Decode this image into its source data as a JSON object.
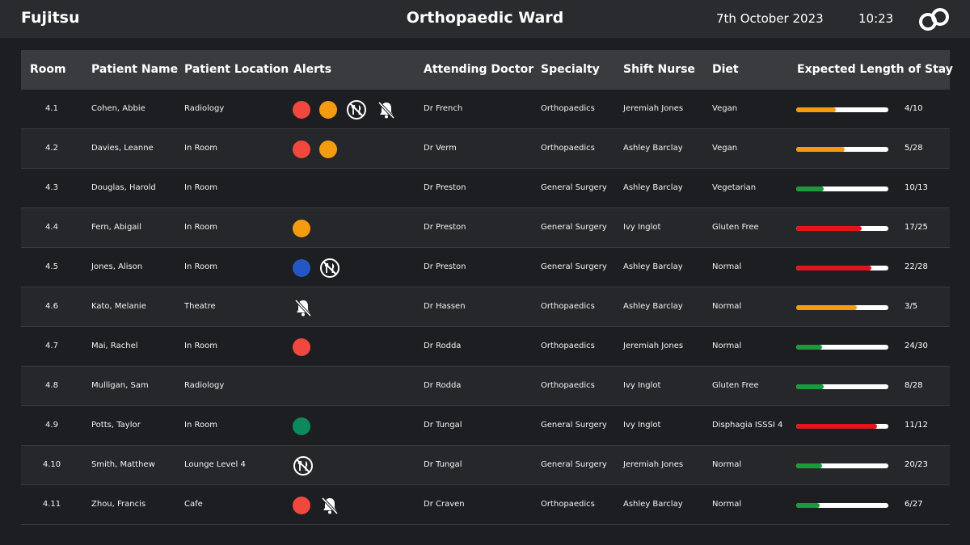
{
  "header": {
    "brand": "Fujitsu",
    "title": "Orthopaedic Ward",
    "date": "7th October 2023",
    "time": "10:23"
  },
  "colors": {
    "red": "#f0483e",
    "orange": "#f39c12",
    "blue": "#2457c5",
    "green": "#0d8a5c",
    "bar_green": "#1a9b3b",
    "bar_orange": "#f39c12",
    "bar_red": "#e3151b"
  },
  "columns": {
    "room": "Room",
    "patient_name": "Patient Name",
    "patient_location": "Patient Location",
    "alerts": "Alerts",
    "attending_doctor": "Attending Doctor",
    "specialty": "Specialty",
    "shift_nurse": "Shift Nurse",
    "diet": "Diet",
    "expected_stay": "Expected Length of Stay"
  },
  "rows": [
    {
      "room": "4.1",
      "name": "Cohen, Abbie",
      "location": "Radiology",
      "alerts": [
        "red-dot",
        "orange-dot",
        "nil-by-mouth-icon",
        "bell-off-icon"
      ],
      "doctor": "Dr French",
      "specialty": "Orthopaedics",
      "nurse": "Jeremiah Jones",
      "diet": "Vegan",
      "stay": "4/10",
      "stay_fraction": 0.43,
      "stay_color": "bar_orange"
    },
    {
      "room": "4.2",
      "name": "Davies, Leanne",
      "location": "In Room",
      "alerts": [
        "red-dot",
        "orange-dot"
      ],
      "doctor": "Dr Verm",
      "specialty": "Orthopaedics",
      "nurse": "Ashley Barclay",
      "diet": "Vegan",
      "stay": "5/28",
      "stay_fraction": 0.53,
      "stay_color": "bar_orange"
    },
    {
      "room": "4.3",
      "name": "Douglas, Harold",
      "location": "In Room",
      "alerts": [],
      "doctor": "Dr Preston",
      "specialty": "General Surgery",
      "nurse": "Ashley Barclay",
      "diet": "Vegetarian",
      "stay": "10/13",
      "stay_fraction": 0.3,
      "stay_color": "bar_green"
    },
    {
      "room": "4.4",
      "name": "Fern, Abigail",
      "location": "In Room",
      "alerts": [
        "orange-dot"
      ],
      "doctor": "Dr Preston",
      "specialty": "General Surgery",
      "nurse": "Ivy Inglot",
      "diet": "Gluten Free",
      "stay": "17/25",
      "stay_fraction": 0.71,
      "stay_color": "bar_red"
    },
    {
      "room": "4.5",
      "name": "Jones, Alison",
      "location": "In Room",
      "alerts": [
        "blue-dot",
        "nil-by-mouth-icon"
      ],
      "doctor": "Dr Preston",
      "specialty": "General Surgery",
      "nurse": "Ashley Barclay",
      "diet": "Normal",
      "stay": "22/28",
      "stay_fraction": 0.82,
      "stay_color": "bar_red"
    },
    {
      "room": "4.6",
      "name": "Kato, Melanie",
      "location": "Theatre",
      "alerts": [
        "bell-off-icon"
      ],
      "doctor": "Dr Hassen",
      "specialty": "Orthopaedics",
      "nurse": "Ashley Barclay",
      "diet": "Normal",
      "stay": "3/5",
      "stay_fraction": 0.66,
      "stay_color": "bar_orange"
    },
    {
      "room": "4.7",
      "name": "Mai, Rachel",
      "location": "In Room",
      "alerts": [
        "red-dot"
      ],
      "doctor": "Dr Rodda",
      "specialty": "Orthopaedics",
      "nurse": "Jeremiah Jones",
      "diet": "Normal",
      "stay": "24/30",
      "stay_fraction": 0.28,
      "stay_color": "bar_green"
    },
    {
      "room": "4.8",
      "name": "Mulligan, Sam",
      "location": "Radiology",
      "alerts": [],
      "doctor": "Dr Rodda",
      "specialty": "Orthopaedics",
      "nurse": "Ivy Inglot",
      "diet": "Gluten Free",
      "stay": "8/28",
      "stay_fraction": 0.3,
      "stay_color": "bar_green"
    },
    {
      "room": "4.9",
      "name": "Potts, Taylor",
      "location": "In Room",
      "alerts": [
        "green-dot"
      ],
      "doctor": "Dr Tungal",
      "specialty": "General Surgery",
      "nurse": "Ivy Inglot",
      "diet": "Disphagia ISSSI 4",
      "stay": "11/12",
      "stay_fraction": 0.88,
      "stay_color": "bar_red"
    },
    {
      "room": "4.10",
      "name": "Smith, Matthew",
      "location": "Lounge Level 4",
      "alerts": [
        "nil-by-mouth-icon"
      ],
      "doctor": "Dr Tungal",
      "specialty": "General Surgery",
      "nurse": "Jeremiah Jones",
      "diet": "Normal",
      "stay": "20/23",
      "stay_fraction": 0.28,
      "stay_color": "bar_green"
    },
    {
      "room": "4.11",
      "name": "Zhou, Francis",
      "location": "Cafe",
      "alerts": [
        "red-dot",
        "bell-off-icon"
      ],
      "doctor": "Dr Craven",
      "specialty": "Orthopaedics",
      "nurse": "Ashley Barclay",
      "diet": "Normal",
      "stay": "6/27",
      "stay_fraction": 0.25,
      "stay_color": "bar_green"
    }
  ]
}
